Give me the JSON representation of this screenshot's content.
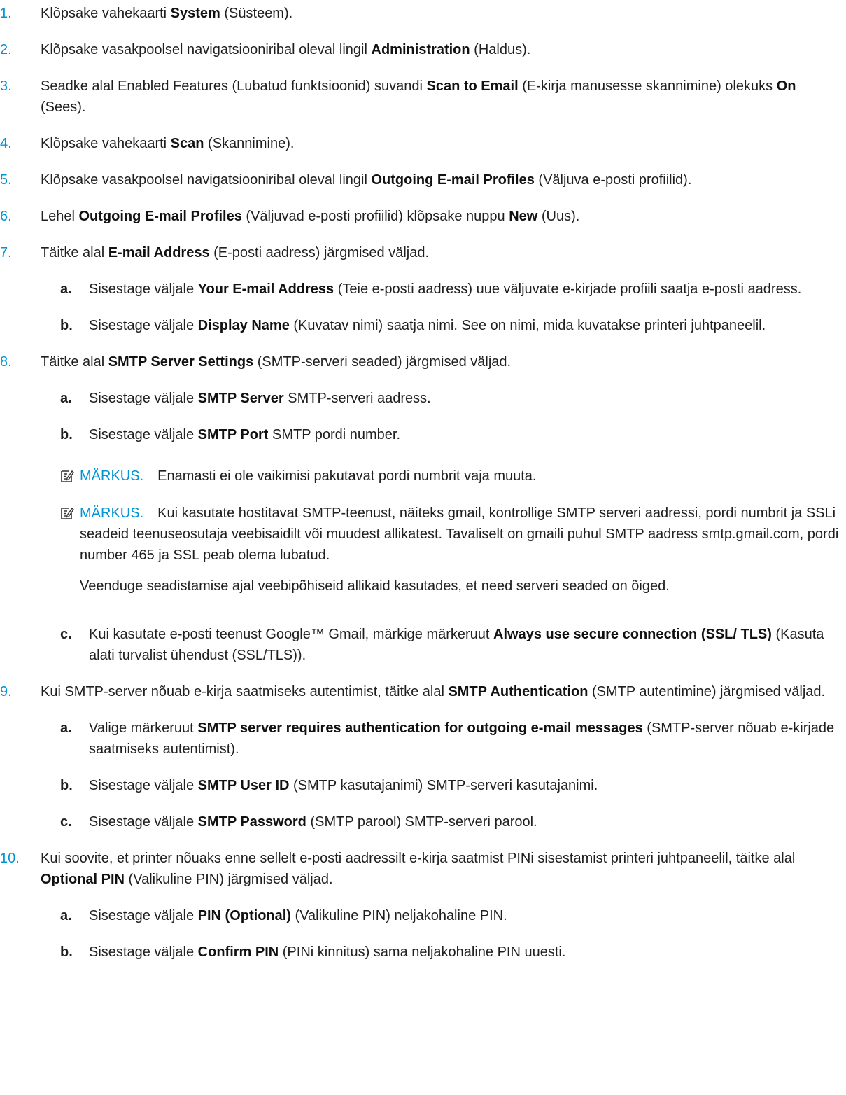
{
  "steps": [
    {
      "num": "1.",
      "parts": [
        "Klõpsake vahekaarti ",
        "System",
        " (Süsteem)."
      ]
    },
    {
      "num": "2.",
      "parts": [
        "Klõpsake vasakpoolsel navigatsiooniribal oleval lingil ",
        "Administration",
        " (Haldus)."
      ]
    },
    {
      "num": "3.",
      "parts": [
        "Seadke alal Enabled Features (Lubatud funktsioonid) suvandi ",
        "Scan to Email",
        " (E-kirja manusesse skannimine) olekuks ",
        "On",
        " (Sees)."
      ]
    },
    {
      "num": "4.",
      "parts": [
        "Klõpsake vahekaarti ",
        "Scan",
        " (Skannimine)."
      ]
    },
    {
      "num": "5.",
      "parts": [
        "Klõpsake vasakpoolsel navigatsiooniribal oleval lingil ",
        "Outgoing E-mail Profiles",
        " (Väljuva e-posti profiilid)."
      ]
    },
    {
      "num": "6.",
      "parts": [
        "Lehel ",
        "Outgoing E-mail Profiles",
        " (Väljuvad e-posti profiilid) klõpsake nuppu ",
        "New",
        " (Uus)."
      ]
    },
    {
      "num": "7.",
      "parts": [
        "Täitke alal ",
        "E-mail Address",
        " (E-posti aadress) järgmised väljad."
      ],
      "subs": [
        {
          "letter": "a.",
          "parts": [
            "Sisestage väljale ",
            "Your E-mail Address",
            " (Teie e-posti aadress) uue väljuvate e-kirjade profiili saatja e-posti aadress."
          ]
        },
        {
          "letter": "b.",
          "parts": [
            "Sisestage väljale ",
            "Display Name",
            " (Kuvatav nimi) saatja nimi. See on nimi, mida kuvatakse printeri juhtpaneelil."
          ]
        }
      ]
    },
    {
      "num": "8.",
      "parts": [
        "Täitke alal ",
        "SMTP Server Settings",
        " (SMTP-serveri seaded) järgmised väljad."
      ],
      "subs": [
        {
          "letter": "a.",
          "parts": [
            "Sisestage väljale ",
            "SMTP Server",
            " SMTP-serveri aadress."
          ]
        },
        {
          "letter": "b.",
          "parts": [
            "Sisestage väljale ",
            "SMTP Port",
            " SMTP pordi number."
          ]
        }
      ],
      "notes": [
        {
          "label": "MÄRKUS.",
          "text": "Enamasti ei ole vaikimisi pakutavat pordi numbrit vaja muuta."
        },
        {
          "label": "MÄRKUS.",
          "text": "Kui kasutate hostitavat SMTP-teenust, näiteks gmail, kontrollige SMTP serveri aadressi, pordi numbrit ja SSLi seadeid teenuseosutaja veebisaidilt või muudest allikatest. Tavaliselt on gmaili puhul SMTP aadress smtp.gmail.com, pordi number 465 ja SSL peab olema lubatud.",
          "extra": "Veenduge seadistamise ajal veebipõhiseid allikaid kasutades, et need serveri seaded on õiged."
        }
      ],
      "subs_after": [
        {
          "letter": "c.",
          "parts": [
            "Kui kasutate e-posti teenust Google™ Gmail, märkige märkeruut ",
            "Always use secure connection (SSL/ TLS)",
            " (Kasuta alati turvalist ühendust (SSL/TLS))."
          ]
        }
      ]
    },
    {
      "num": "9.",
      "parts": [
        "Kui SMTP-server nõuab e-kirja saatmiseks autentimist, täitke alal ",
        "SMTP Authentication",
        " (SMTP autentimine) järgmised väljad."
      ],
      "subs": [
        {
          "letter": "a.",
          "parts": [
            "Valige märkeruut ",
            "SMTP server requires authentication for outgoing e-mail messages",
            " (SMTP-server nõuab e-kirjade saatmiseks autentimist)."
          ]
        },
        {
          "letter": "b.",
          "parts": [
            "Sisestage väljale ",
            "SMTP User ID",
            " (SMTP kasutajanimi) SMTP-serveri kasutajanimi."
          ]
        },
        {
          "letter": "c.",
          "parts": [
            "Sisestage väljale ",
            "SMTP Password",
            " (SMTP parool) SMTP-serveri parool."
          ]
        }
      ]
    },
    {
      "num": "10.",
      "parts": [
        "Kui soovite, et printer nõuaks enne sellelt e-posti aadressilt e-kirja saatmist PINi sisestamist printeri juhtpaneelil, täitke alal ",
        "Optional PIN",
        " (Valikuline PIN) järgmised väljad."
      ],
      "subs": [
        {
          "letter": "a.",
          "parts": [
            "Sisestage väljale ",
            "PIN (Optional)",
            " (Valikuline PIN) neljakohaline PIN."
          ]
        },
        {
          "letter": "b.",
          "parts": [
            "Sisestage väljale ",
            "Confirm PIN",
            " (PINi kinnitus) sama neljakohaline PIN uuesti."
          ]
        }
      ]
    }
  ],
  "colors": {
    "accent": "#0096d6",
    "text": "#1f1f1f"
  },
  "icons": {
    "note": "note-icon"
  }
}
